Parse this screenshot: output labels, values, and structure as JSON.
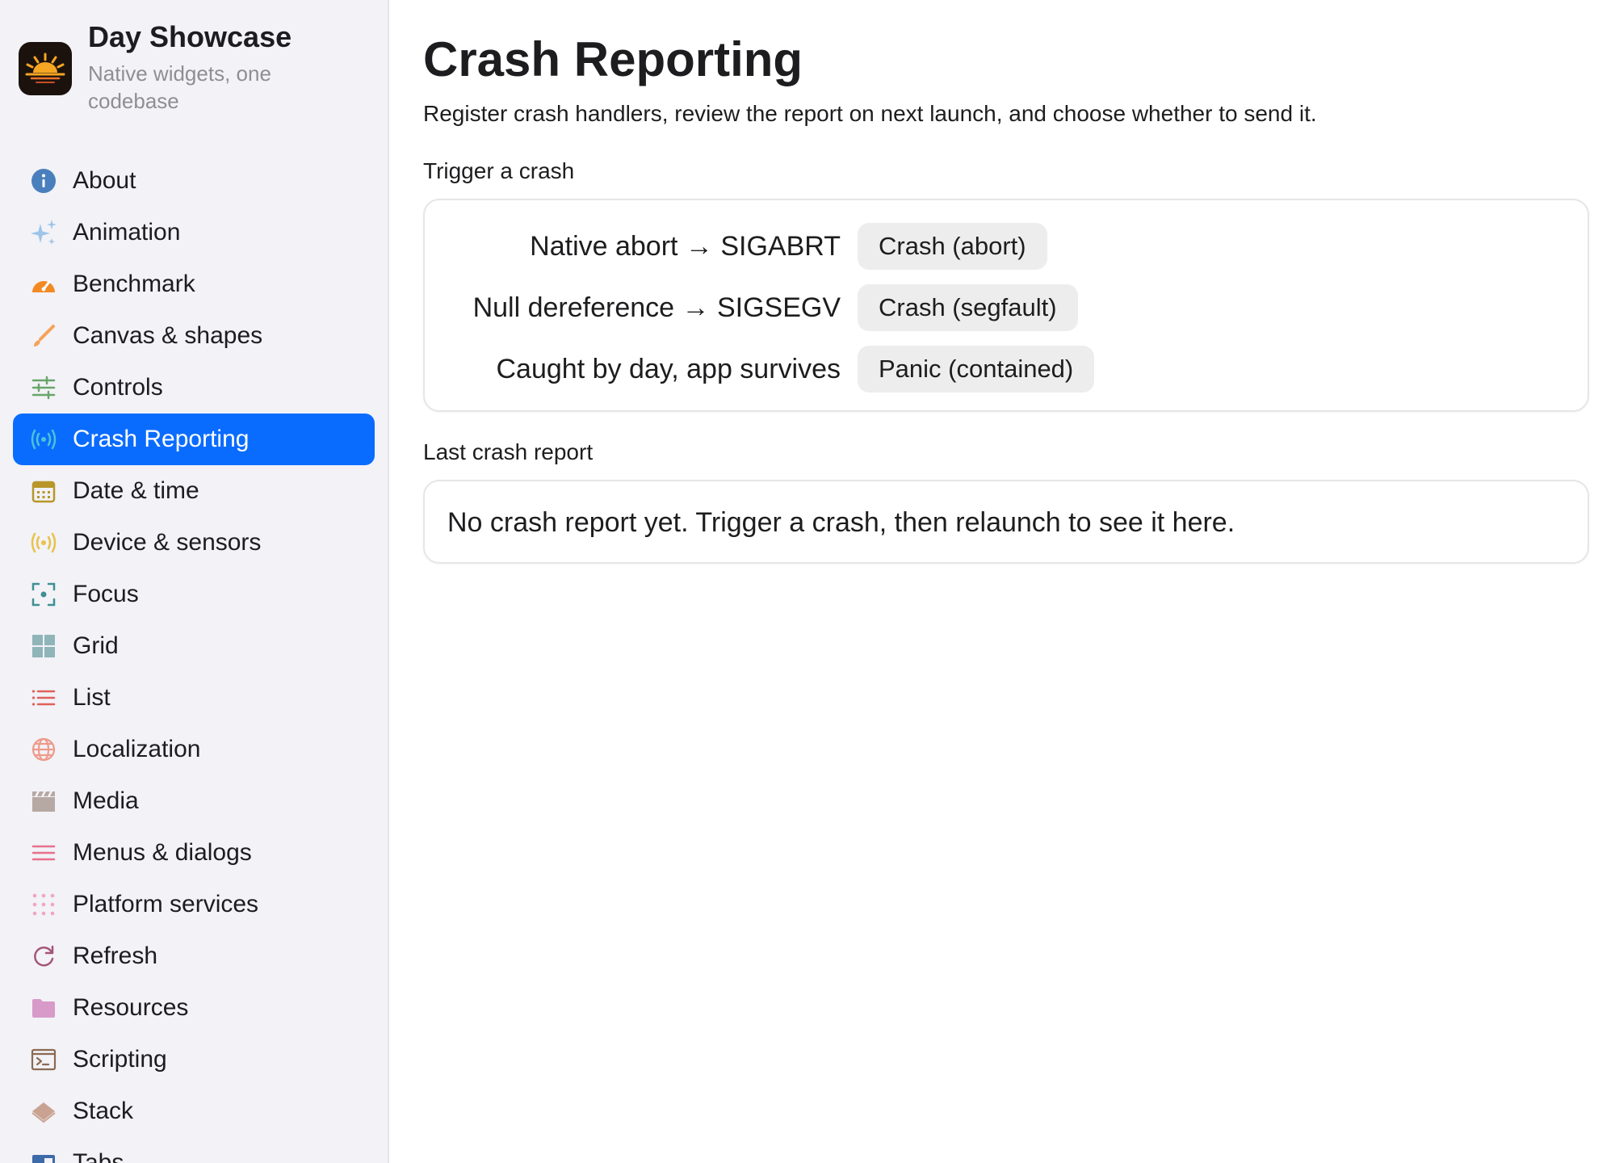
{
  "app": {
    "name": "Day Showcase",
    "subtitle_line1": "Native widgets, one",
    "subtitle_line2": "codebase"
  },
  "sidebar": {
    "items": [
      {
        "label": "About",
        "icon": "info-icon",
        "color": "#4a7fbd"
      },
      {
        "label": "Animation",
        "icon": "sparkles-icon",
        "color": "#9ec4e8"
      },
      {
        "label": "Benchmark",
        "icon": "gauge-icon",
        "color": "#f28a24"
      },
      {
        "label": "Canvas & shapes",
        "icon": "brush-icon",
        "color": "#f5a25a"
      },
      {
        "label": "Controls",
        "icon": "sliders-icon",
        "color": "#6aa56a"
      },
      {
        "label": "Crash Reporting",
        "icon": "broadcast-icon",
        "color": "#4cc2d6",
        "active": true
      },
      {
        "label": "Date & time",
        "icon": "calendar-icon",
        "color": "#b8962a"
      },
      {
        "label": "Device & sensors",
        "icon": "signal-icon",
        "color": "#e8c24a"
      },
      {
        "label": "Focus",
        "icon": "focus-icon",
        "color": "#3f8f94"
      },
      {
        "label": "Grid",
        "icon": "grid-icon",
        "color": "#8fb5b8"
      },
      {
        "label": "List",
        "icon": "list-icon",
        "color": "#e0605a"
      },
      {
        "label": "Localization",
        "icon": "globe-icon",
        "color": "#ee9a8a"
      },
      {
        "label": "Media",
        "icon": "clapperboard-icon",
        "color": "#b6a8a2"
      },
      {
        "label": "Menus & dialogs",
        "icon": "menu-icon",
        "color": "#e8708c"
      },
      {
        "label": "Platform services",
        "icon": "dots-grid-icon",
        "color": "#f0a6c0"
      },
      {
        "label": "Refresh",
        "icon": "refresh-icon",
        "color": "#a5557a"
      },
      {
        "label": "Resources",
        "icon": "folder-icon",
        "color": "#d89ac8"
      },
      {
        "label": "Scripting",
        "icon": "terminal-icon",
        "color": "#8a6a52"
      },
      {
        "label": "Stack",
        "icon": "layers-icon",
        "color": "#c9a292"
      },
      {
        "label": "Tabs",
        "icon": "tabs-icon",
        "color": "#3d6aa8"
      }
    ]
  },
  "main": {
    "title": "Crash Reporting",
    "description": "Register crash handlers, review the report on next launch, and choose whether to send it.",
    "trigger_section": {
      "label": "Trigger a crash",
      "rows": [
        {
          "label": "Native abort → SIGABRT",
          "button": "Crash (abort)"
        },
        {
          "label": "Null dereference → SIGSEGV",
          "button": "Crash (segfault)"
        },
        {
          "label": "Caught by day, app survives",
          "button": "Panic (contained)"
        }
      ]
    },
    "report_section": {
      "label": "Last crash report",
      "empty_text": "No crash report yet. Trigger a crash, then relaunch to see it here."
    }
  },
  "colors": {
    "accent": "#0a6cff",
    "sidebar_bg": "#f2f2f7",
    "button_bg": "#ededed"
  }
}
